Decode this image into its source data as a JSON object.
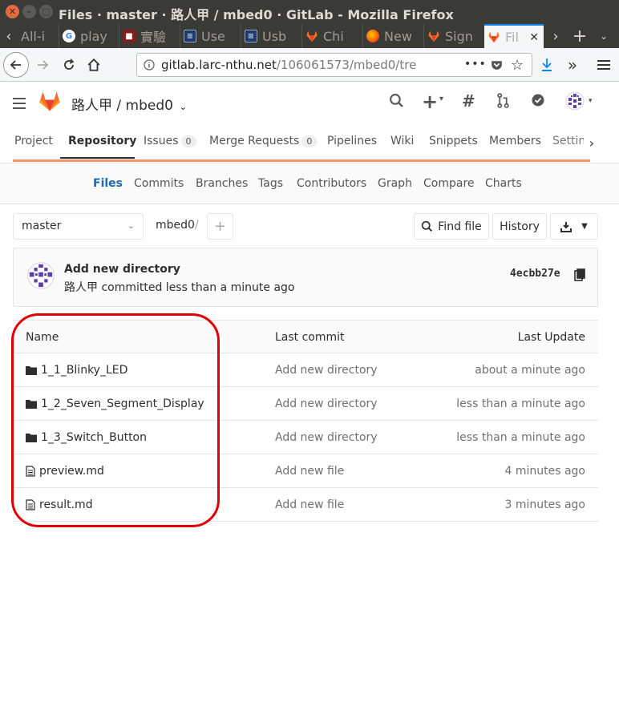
{
  "window": {
    "title": "Files · master · 路人甲 / mbed0 · GitLab - Mozilla Firefox"
  },
  "tabs": [
    {
      "label": "All-i",
      "icon": "blank-icon"
    },
    {
      "label": "play",
      "icon": "google-icon"
    },
    {
      "label": "實驗",
      "icon": "bookmark-red-icon"
    },
    {
      "label": "Use",
      "icon": "document-icon"
    },
    {
      "label": "Usb",
      "icon": "document-icon"
    },
    {
      "label": "Chi",
      "icon": "gitlab-icon"
    },
    {
      "label": "New",
      "icon": "firefox-icon"
    },
    {
      "label": "Sign",
      "icon": "gitlab-icon"
    },
    {
      "label": "Fil",
      "icon": "gitlab-icon"
    }
  ],
  "navbar": {
    "url_host": "gitlab.larc-nthu.net",
    "url_path": "/106061573/mbed0/tre",
    "more": "•••"
  },
  "header": {
    "project_path": "路人甲 / mbed0"
  },
  "project_nav": {
    "items": [
      {
        "label": "Project"
      },
      {
        "label": "Repository"
      },
      {
        "label": "Issues",
        "count": "0"
      },
      {
        "label": "Merge Requests",
        "count": "0"
      },
      {
        "label": "Pipelines"
      },
      {
        "label": "Wiki"
      },
      {
        "label": "Snippets"
      },
      {
        "label": "Members"
      },
      {
        "label": "Settin"
      }
    ]
  },
  "sub_nav": {
    "items": [
      "Files",
      "Commits",
      "Branches",
      "Tags",
      "Contributors",
      "Graph",
      "Compare",
      "Charts"
    ]
  },
  "tree": {
    "branch": "master",
    "path": "mbed0",
    "separator": "/",
    "find_file": "Find file",
    "history": "History"
  },
  "commit": {
    "title": "Add new directory",
    "meta": "路人甲 committed less than a minute ago",
    "sha": "4ecbb27e"
  },
  "files": {
    "headers": {
      "name": "Name",
      "last_commit": "Last commit",
      "last_update": "Last Update"
    },
    "rows": [
      {
        "type": "folder",
        "name": "1_1_Blinky_LED",
        "commit": "Add new directory",
        "updated": "about a minute ago"
      },
      {
        "type": "folder",
        "name": "1_2_Seven_Segment_Display",
        "commit": "Add new directory",
        "updated": "less than a minute ago"
      },
      {
        "type": "folder",
        "name": "1_3_Switch_Button",
        "commit": "Add new directory",
        "updated": "less than a minute ago"
      },
      {
        "type": "file",
        "name": "preview.md",
        "commit": "Add new file",
        "updated": "4 minutes ago"
      },
      {
        "type": "file",
        "name": "result.md",
        "commit": "Add new file",
        "updated": "3 minutes ago"
      }
    ]
  },
  "colors": {
    "gitlab_orange": "#fc6d26",
    "accent_blue": "#1b69b6",
    "annotation_red": "#e00000"
  }
}
